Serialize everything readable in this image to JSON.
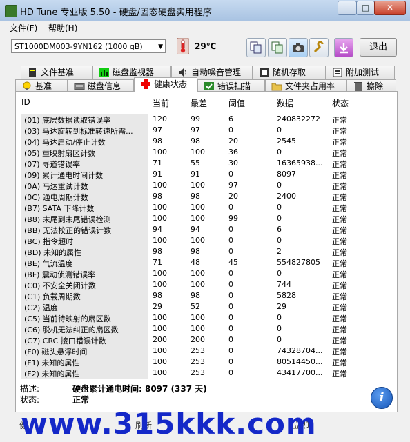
{
  "window": {
    "title": "HD Tune 专业版 5.50 - 硬盘/固态硬盘实用程序",
    "minimize": "_",
    "maximize": "□",
    "close": "✕"
  },
  "menu": {
    "file": "文件(F)",
    "help": "帮助(H)"
  },
  "toolbar": {
    "drive": "ST1000DM003-9YN162 (1000 gB)",
    "temperature": "29℃",
    "exit_label": "退出"
  },
  "tabs": {
    "row1": [
      "文件基准",
      "磁盘监视器",
      "自动噪音管理",
      "随机存取",
      "附加测试"
    ],
    "row2": [
      "基准",
      "磁盘信息",
      "健康状态",
      "错误扫描",
      "文件夹占用率",
      "擦除"
    ]
  },
  "table": {
    "headers": [
      "ID",
      "当前",
      "最差",
      "阈值",
      "数据",
      "状态"
    ],
    "rows": [
      [
        "(01) 底层数据读取错误率",
        "120",
        "99",
        "6",
        "240832272",
        "正常"
      ],
      [
        "(03) 马达旋转到标准转速所需...",
        "97",
        "97",
        "0",
        "0",
        "正常"
      ],
      [
        "(04) 马达启动/停止计数",
        "98",
        "98",
        "20",
        "2545",
        "正常"
      ],
      [
        "(05) 重映射扇区计数",
        "100",
        "100",
        "36",
        "0",
        "正常"
      ],
      [
        "(07) 寻道错误率",
        "71",
        "55",
        "30",
        "16365938...",
        "正常"
      ],
      [
        "(09) 累计通电时间计数",
        "91",
        "91",
        "0",
        "8097",
        "正常"
      ],
      [
        "(0A) 马达重试计数",
        "100",
        "100",
        "97",
        "0",
        "正常"
      ],
      [
        "(0C) 通电周期计数",
        "98",
        "98",
        "20",
        "2400",
        "正常"
      ],
      [
        "(B7) SATA 下降计数",
        "100",
        "100",
        "0",
        "0",
        "正常"
      ],
      [
        "(B8) 末尾到末尾错误检测",
        "100",
        "100",
        "99",
        "0",
        "正常"
      ],
      [
        "(BB) 无法校正的错误计数",
        "94",
        "94",
        "0",
        "6",
        "正常"
      ],
      [
        "(BC) 指令超时",
        "100",
        "100",
        "0",
        "0",
        "正常"
      ],
      [
        "(BD) 未知的属性",
        "98",
        "98",
        "0",
        "2",
        "正常"
      ],
      [
        "(BE) 气流温度",
        "71",
        "48",
        "45",
        "554827805",
        "正常"
      ],
      [
        "(BF) 震动侦测错误率",
        "100",
        "100",
        "0",
        "0",
        "正常"
      ],
      [
        "(C0) 不安全关闭计数",
        "100",
        "100",
        "0",
        "744",
        "正常"
      ],
      [
        "(C1) 负载周期数",
        "98",
        "98",
        "0",
        "5828",
        "正常"
      ],
      [
        "(C2) 温度",
        "29",
        "52",
        "0",
        "29",
        "正常"
      ],
      [
        "(C5) 当前待映射的扇区数",
        "100",
        "100",
        "0",
        "0",
        "正常"
      ],
      [
        "(C6) 脱机无法纠正的扇区数",
        "100",
        "100",
        "0",
        "0",
        "正常"
      ],
      [
        "(C7) CRC 接口错误计数",
        "200",
        "200",
        "0",
        "0",
        "正常"
      ],
      [
        "(F0) 磁头悬浮时间",
        "100",
        "253",
        "0",
        "74328704...",
        "正常"
      ],
      [
        "(F1) 未知的属性",
        "100",
        "253",
        "0",
        "80514450...",
        "正常"
      ],
      [
        "(F2) 未知的属性",
        "100",
        "253",
        "0",
        "43417700...",
        "正常"
      ]
    ]
  },
  "description": {
    "desc_label": "描述:",
    "desc_value": "硬盘累计通电时间: 8097 (337 天)",
    "state_label": "状态:",
    "state_value": "正常"
  },
  "footer": {
    "watermark": "www.315kkk.com",
    "left_partial": "健",
    "refresh_partial": "刷新",
    "right_partial": "立即"
  },
  "colors": {
    "window_bg": "#d9e4f1",
    "watermark": "#1428c8"
  }
}
